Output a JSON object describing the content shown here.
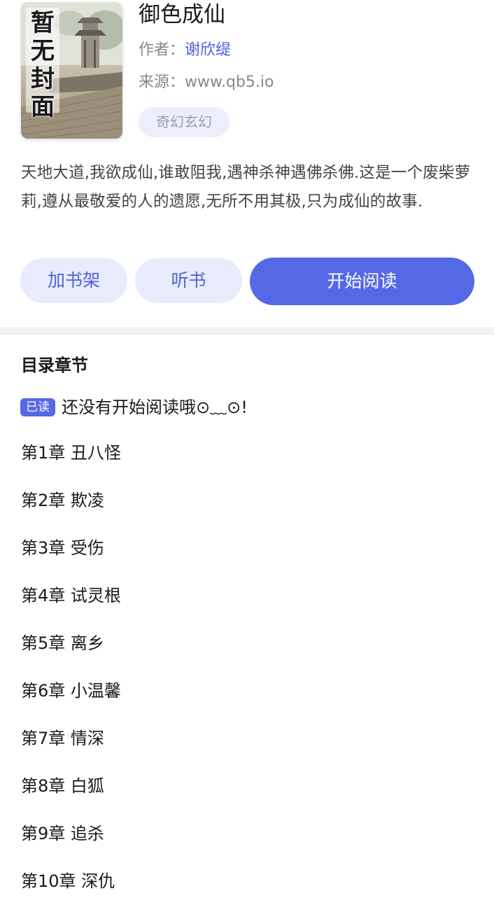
{
  "book": {
    "cover_text": [
      "暂",
      "无",
      "封",
      "面"
    ],
    "title": "御色成仙",
    "author_label": "作者：",
    "author": "谢欣缇",
    "source_label": "来源：",
    "source": "www.qb5.io",
    "tag": "奇幻玄幻",
    "intro": "天地大道,我欲成仙,谁敢阻我,遇神杀神遇佛杀佛.这是一个废柴萝莉,遵从最敬爱的人的遗愿,无所不用其极,只为成仙的故事."
  },
  "actions": {
    "add_shelf": "加书架",
    "listen": "听书",
    "start_reading": "开始阅读"
  },
  "catalog": {
    "title": "目录章节",
    "read_badge": "已读",
    "progress_text": "还没有开始阅读哦⊙﹏⊙!",
    "chapters": [
      "第1章 丑八怪",
      "第2章 欺凌",
      "第3章 受伤",
      "第4章 试灵根",
      "第5章 离乡",
      "第6章 小温馨",
      "第7章 情深",
      "第8章 白狐",
      "第9章 追杀",
      "第10章 深仇"
    ]
  },
  "colors": {
    "accent": "#5568e6",
    "accent_light": "#e8ebfb",
    "author_link": "#4f63d8"
  }
}
